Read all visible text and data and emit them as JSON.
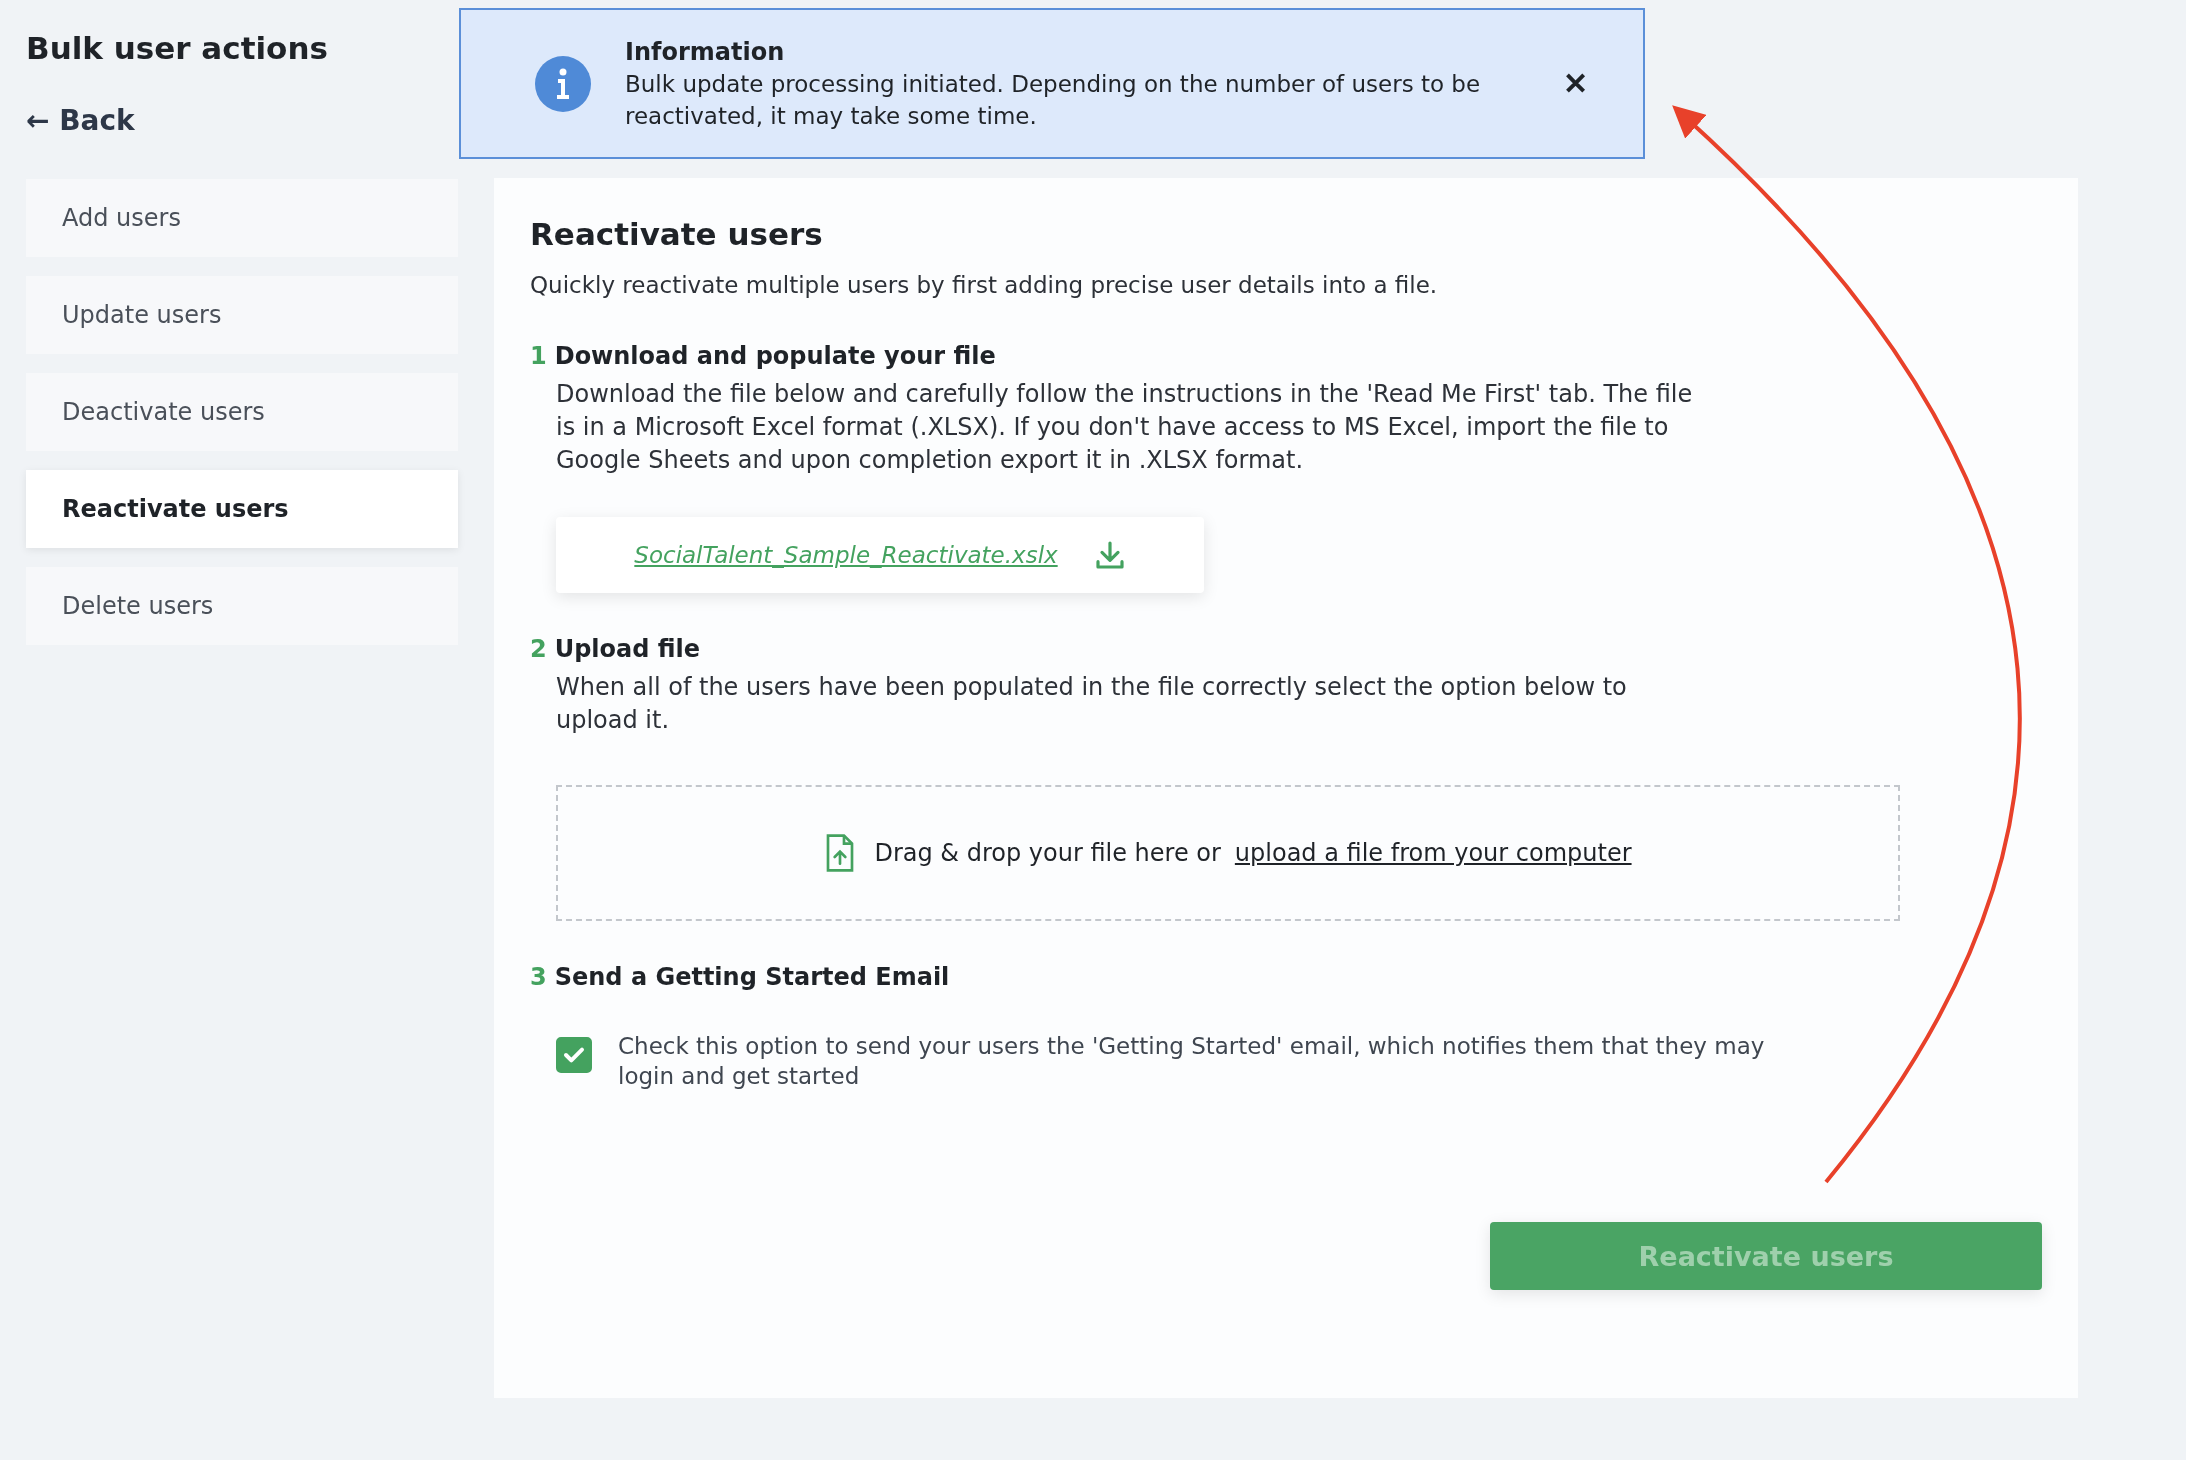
{
  "page_title": "Bulk user actions",
  "back_link": {
    "arrow": "←",
    "label": "Back"
  },
  "sidebar": {
    "items": [
      {
        "label": "Add users",
        "selected": false
      },
      {
        "label": "Update users",
        "selected": false
      },
      {
        "label": "Deactivate users",
        "selected": false
      },
      {
        "label": "Reactivate users",
        "selected": true
      },
      {
        "label": "Delete users",
        "selected": false
      }
    ]
  },
  "notification": {
    "title": "Information",
    "message": "Bulk update processing initiated. Depending on the number of users to be reactivated, it may take some time.",
    "close": "✕"
  },
  "panel": {
    "title": "Reactivate users",
    "subtitle": "Quickly reactivate multiple users by first adding precise user details into a file.",
    "steps": [
      {
        "kind": "download",
        "number": "1",
        "title": "Download and populate your file",
        "text": "Download the file below and carefully follow the instructions in the 'Read Me First' tab. The file is in a Microsoft Excel format (.XLSX). If you don't have access to MS Excel, import the file to Google Sheets and upon completion export it in .XLSX format.",
        "file_link": "SocialTalent_Sample_Reactivate.xslx"
      },
      {
        "kind": "upload",
        "number": "2",
        "title": "Upload file",
        "text": "When all of the users have been populated in the file correctly select the option below to upload it.",
        "drop_text": "Drag & drop your file here or",
        "upload_link": "upload a file from your computer"
      },
      {
        "kind": "checkbox",
        "number": "3",
        "title": "Send a Getting Started Email",
        "checked": true,
        "text": "Check this option to send your users the 'Getting Started' email, which notifies them that they may login and get started"
      }
    ],
    "submit": {
      "label": "Reactivate users",
      "disabled": true
    }
  }
}
